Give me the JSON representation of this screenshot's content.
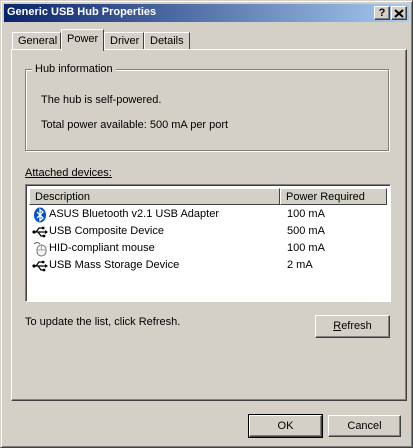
{
  "window": {
    "title": "Generic USB Hub Properties",
    "help_button": "?",
    "close_button": "X"
  },
  "tabs": [
    {
      "label": "General"
    },
    {
      "label": "Power"
    },
    {
      "label": "Driver"
    },
    {
      "label": "Details"
    }
  ],
  "active_tab": "Power",
  "hub_info": {
    "group_label": "Hub information",
    "self_powered": "The hub is self-powered.",
    "total_power": "Total power available:  500 mA per port"
  },
  "attached": {
    "label": "Attached devices:",
    "columns": [
      "Description",
      "Power Required"
    ],
    "rows": [
      {
        "icon": "bluetooth-icon",
        "description": "ASUS Bluetooth v2.1 USB Adapter",
        "power": "100 mA"
      },
      {
        "icon": "usb-icon",
        "description": "USB Composite Device",
        "power": "500 mA"
      },
      {
        "icon": "mouse-icon",
        "description": "HID-compliant mouse",
        "power": "100 mA"
      },
      {
        "icon": "usb-icon",
        "description": "USB Mass Storage Device",
        "power": "2 mA"
      }
    ]
  },
  "refresh_hint": "To update the list, click Refresh.",
  "buttons": {
    "refresh_first": "R",
    "refresh_rest": "efresh",
    "ok": "OK",
    "cancel": "Cancel"
  },
  "colors": {
    "titlebar_start": "#0a246a",
    "titlebar_end": "#a6caf0",
    "bluetooth": "#0050c8"
  }
}
